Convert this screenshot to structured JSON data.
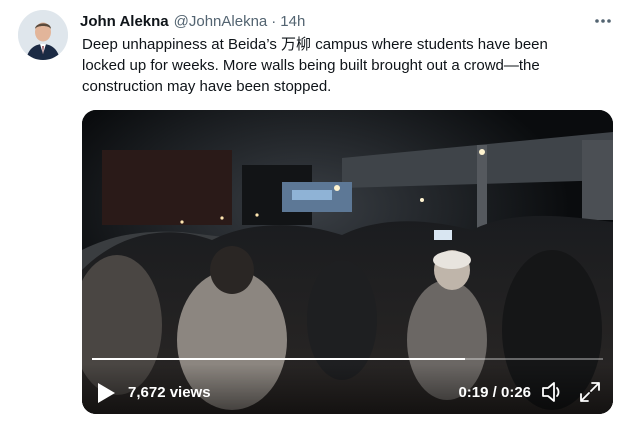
{
  "tweet": {
    "author_name": "John Alekna",
    "author_handle": "@JohnAlekna",
    "separator": "·",
    "time": "14h",
    "text": "Deep unhappiness at Beida’s 万柳 campus where students have been locked up for weeks. More walls being built brought out a crowd—the construction may have been stopped."
  },
  "video": {
    "views": "7,672 views",
    "timecode": "0:19 / 0:26",
    "progress_fraction": 0.73
  },
  "icons": {
    "more": "more-horizontal-icon",
    "play": "play-icon",
    "volume": "volume-muted-icon",
    "fullscreen": "fullscreen-icon"
  }
}
